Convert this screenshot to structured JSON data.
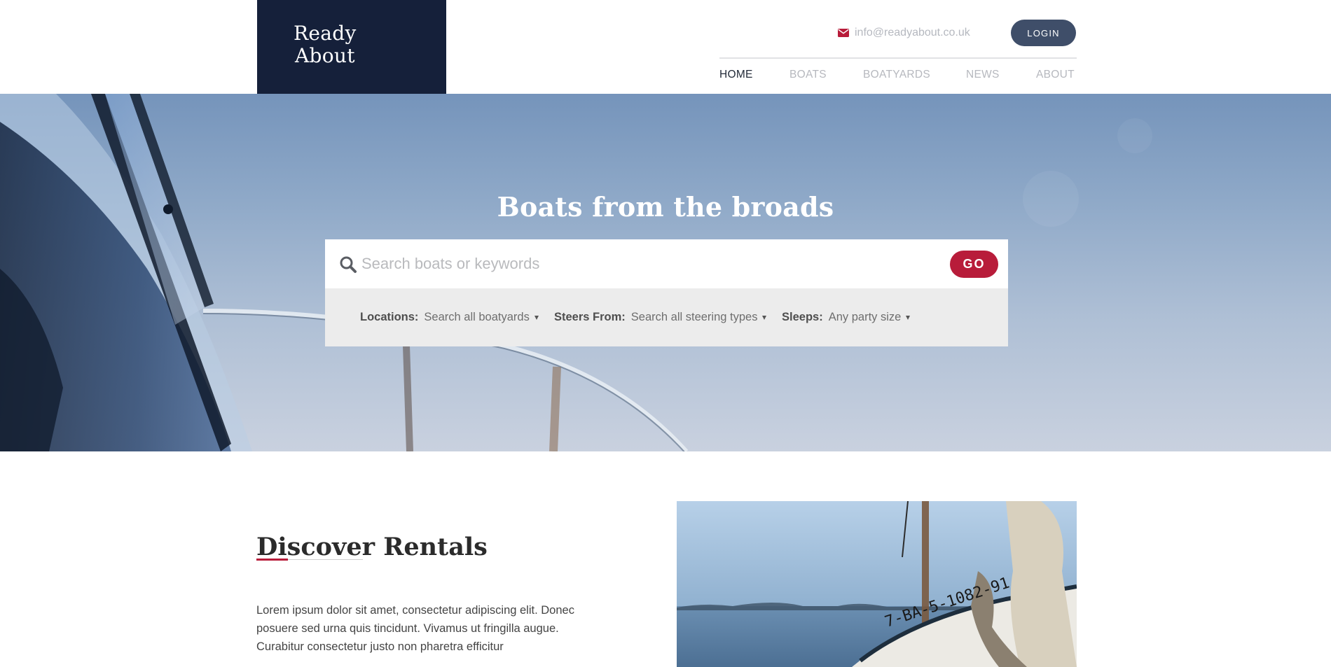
{
  "header": {
    "logo_line1": "Ready",
    "logo_line2": "About",
    "email": "info@readyabout.co.uk",
    "login_label": "LOGIN",
    "nav": [
      {
        "label": "HOME",
        "active": true
      },
      {
        "label": "BOATS",
        "active": false
      },
      {
        "label": "BOATYARDS",
        "active": false
      },
      {
        "label": "NEWS",
        "active": false
      },
      {
        "label": "ABOUT",
        "active": false
      }
    ]
  },
  "hero": {
    "title": "Boats from the broads",
    "search": {
      "placeholder": "Search boats or keywords",
      "value": "",
      "go_label": "GO"
    },
    "filters": [
      {
        "label": "Locations:",
        "value": "Search all boatyards"
      },
      {
        "label": "Steers From:",
        "value": "Search all steering types"
      },
      {
        "label": "Sleeps:",
        "value": "Any party size"
      }
    ]
  },
  "discover": {
    "title": "Discover Rentals",
    "body": "Lorem ipsum dolor sit amet, consectetur adipiscing elit. Donec posuere sed urna quis tincidunt. Vivamus ut fringilla augue. Curabitur consectetur justo non pharetra efficitur",
    "boat_registration": "7-BA-5-1082-91"
  },
  "colors": {
    "navy": "#15203a",
    "accent_red": "#b81c3a",
    "login_bg": "#3f4e69"
  },
  "icons": {
    "email": "envelope-icon",
    "search": "magnifier-icon",
    "dropdown": "caret-down-icon"
  }
}
